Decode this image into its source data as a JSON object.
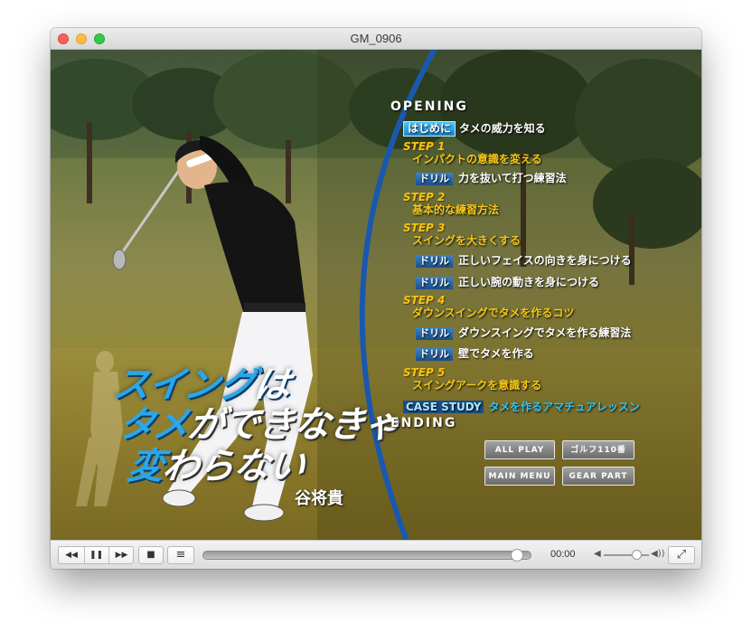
{
  "window": {
    "title": "GM_0906"
  },
  "artwork": {
    "title_line1_a": "スイング",
    "title_line1_b": "は",
    "title_line2_a": "タメ",
    "title_line2_b": "ができなきゃ",
    "title_line3_a": "変",
    "title_line3_b": "わらない",
    "author": "谷将貴"
  },
  "menu": {
    "opening": "OPENING",
    "intro_tag": "はじめに",
    "intro_title": "タメの威力を知る",
    "step1_label": "STEP 1",
    "step1_title": "インパクトの意識を変える",
    "drill_tag": "ドリル",
    "step1_drill1": "力を抜いて打つ練習法",
    "step2_label": "STEP 2",
    "step2_title": "基本的な練習方法",
    "step3_label": "STEP 3",
    "step3_title": "スイングを大きくする",
    "step3_drill1": "正しいフェイスの向きを身につける",
    "step3_drill2": "正しい腕の動きを身につける",
    "step4_label": "STEP 4",
    "step4_title": "ダウンスイングでタメを作るコツ",
    "step4_drill1": "ダウンスイングでタメを作る練習法",
    "step4_drill2": "壁でタメを作る",
    "step5_label": "STEP 5",
    "step5_title": "スイングアークを意識する",
    "case_label": "CASE STUDY",
    "case_title": "タメを作るアマチュアレッスン",
    "ending": "ENDING",
    "buttons": {
      "all_play": "ALL PLAY",
      "golf110": "ゴルフ110番",
      "main_menu": "MAIN MENU",
      "gear_part": "GEAR PART"
    }
  },
  "controls": {
    "rewind": "◀◀",
    "pause": "❚❚",
    "forward": "▶▶",
    "stop": "■",
    "playlist": "≡",
    "time": "00:00",
    "vol_low": "◀",
    "vol_high": "◀))",
    "fullscreen": "⤢",
    "progress": 0.97,
    "volume": 0.72
  }
}
